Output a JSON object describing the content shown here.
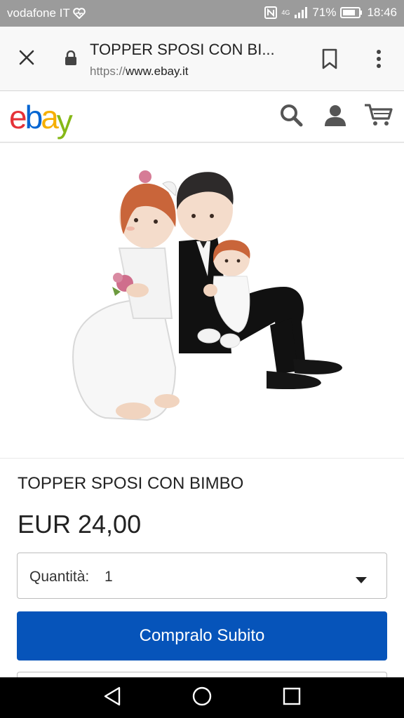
{
  "status_bar": {
    "carrier": "vodafone IT",
    "network": "4G",
    "battery": "71%",
    "time": "18:46",
    "background": "#9b9b9b"
  },
  "browser": {
    "page_title": "TOPPER SPOSI CON BI...",
    "url_scheme": "https://",
    "url_host": "www.ebay.it",
    "icons": [
      "close-icon",
      "lock-icon",
      "bookmark-icon",
      "more-vert-icon"
    ]
  },
  "ebay_header": {
    "logo_letters": [
      "e",
      "b",
      "a",
      "y"
    ],
    "logo_colors": [
      "#e53238",
      "#0064d2",
      "#f5af02",
      "#86b817"
    ],
    "icons": [
      "search-icon",
      "account-icon",
      "cart-icon"
    ]
  },
  "product": {
    "image_alt": "Wedding cake topper: bride and groom sitting back to back, groom holding a baby",
    "title": "TOPPER SPOSI CON BIMBO",
    "price": "EUR 24,00"
  },
  "quantity": {
    "label": "Quantità:",
    "value": "1"
  },
  "buy_button": {
    "label": "Compralo Subito",
    "color": "#0654ba"
  },
  "nav_bar": {
    "icons": [
      "back-icon",
      "home-icon",
      "recents-icon"
    ]
  }
}
